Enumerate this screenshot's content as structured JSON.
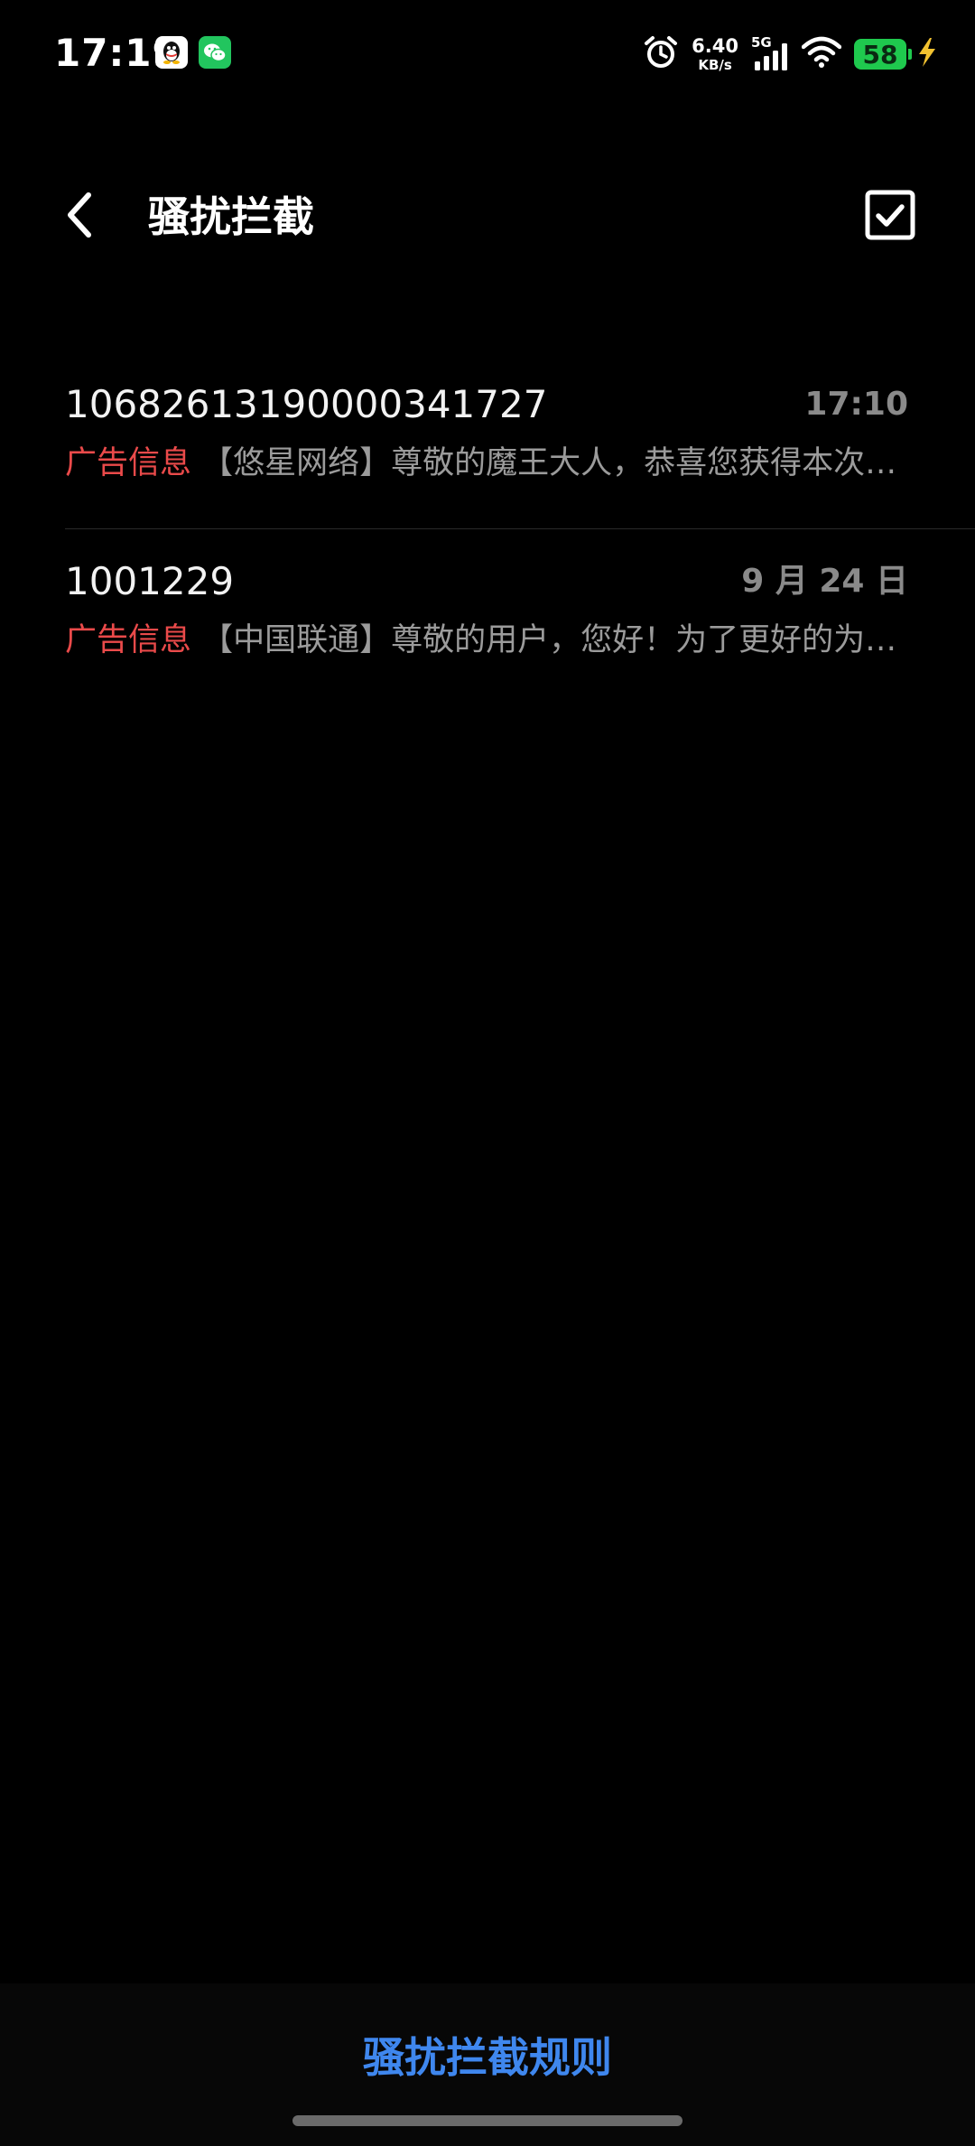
{
  "status_bar": {
    "time": "17:19",
    "net_speed_value": "6.40",
    "net_speed_unit": "KB/s",
    "network_type": "5G",
    "battery_level": "58",
    "icons": [
      "qq-icon",
      "wechat-icon",
      "alarm-icon",
      "signal-icon",
      "wifi-icon",
      "battery-icon",
      "charging-icon"
    ]
  },
  "header": {
    "title": "骚扰拦截",
    "back_icon": "chevron-left-icon",
    "select_icon": "checkbox-checked-icon"
  },
  "messages": [
    {
      "sender": "10682613190000341727",
      "time": "17:10",
      "tag": "广告信息",
      "preview": "【悠星网络】尊敬的魔王大人，恭喜您获得本次…"
    },
    {
      "sender": "1001229",
      "time": "9 月 24 日",
      "tag": "广告信息",
      "preview": "【中国联通】尊敬的用户，您好！为了更好的为…"
    }
  ],
  "bottom": {
    "rules_label": "骚扰拦截规则"
  },
  "colors": {
    "background": "#000000",
    "tag_red": "#ea4a4a",
    "accent_blue": "#3f87ee",
    "battery_green": "#1fc94e"
  }
}
